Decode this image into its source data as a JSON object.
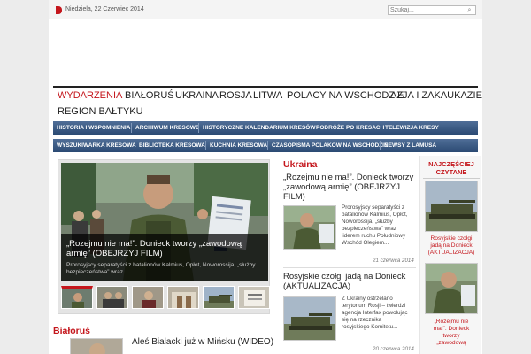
{
  "topbar": {
    "date": "Niedziela, 22 Czerwiec 2014",
    "search_placeholder": "Szukaj..."
  },
  "main_nav": [
    {
      "label": "WYDARZENIA",
      "active": true
    },
    {
      "label": "BIAŁORUŚ"
    },
    {
      "label": "UKRAINA"
    },
    {
      "label": "ROSJA"
    },
    {
      "label": "LITWA"
    },
    {
      "label": "POLACY NA WSCHODZIE"
    },
    {
      "label": "AZJA I ZAKAUKAZIE"
    },
    {
      "label": "REGION BAŁTYKU"
    }
  ],
  "sub_nav_1": [
    "HISTORIA I WSPOMNIENIA",
    "ARCHIWUM KRESOWE",
    "HISTORYCZNE KALENDARIUM KRESÓW",
    "PODRÓŻE PO KRESACH",
    "TELEWIZJA KRESY"
  ],
  "sub_nav_2": [
    "WYSZUKIWARKA KRESOWA",
    "BIBLIOTEKA KRESOWA",
    "KUCHNIA KRESOWA",
    "CZASOPISMA POLAKÓW NA WSCHODZIE",
    "NEWSY Z LAMUSA"
  ],
  "featured": {
    "title": "„Rozejmu nie ma!”. Donieck tworzy „zawodową armię” (OBEJRZYJ FILM)",
    "excerpt": "Prorosyjscy separatyści z batalionów Kalmius, Opłot, Noworossija, „służby bezpieczeństwa” wraz..."
  },
  "ukraina": {
    "section": "Ukraina",
    "articles": [
      {
        "title": "„Rozejmu nie ma!”. Donieck tworzy „zawodową armię” (OBEJRZYJ FILM)",
        "excerpt": [
          "Prorosyjscy separatyści z",
          "batalionów Kalmius, Opłot,",
          "Noworossija, „służby",
          "bezpieczeństwa” wraz",
          "liderem ruchu Południowy",
          "Wschód Olegiem..."
        ],
        "date": "21 czerwca 2014"
      },
      {
        "title": "Rosyjskie czołgi jadą na Donieck (AKTUALIZACJA)",
        "excerpt": [
          "Z Ukrainy ostrzelano",
          "terytorium Rosji – twierdzi",
          "agencja Interfax powołując",
          "się na rzecznika",
          "rosyjskiego Komitetu..."
        ],
        "date": "20 czerwca 2014"
      }
    ]
  },
  "bialorus": {
    "section": "Białoruś",
    "article_title": "Aleś Bialacki już w Mińsku (WIDEO)"
  },
  "sidebar": {
    "heading": [
      "NAJCZĘŚCIEJ",
      "CZYTANE"
    ],
    "items": [
      {
        "caption": [
          "Rosyjskie czołgi",
          "jadą na Donieck",
          "(AKTUALIZACJA)"
        ]
      },
      {
        "caption": [
          "„Rozejmu nie",
          "ma!”. Donieck",
          "tworzy",
          "„zawodową"
        ]
      }
    ]
  },
  "colors": {
    "accent": "#c4161c",
    "nav_blue": "#2b4a73",
    "text": "#222222"
  }
}
